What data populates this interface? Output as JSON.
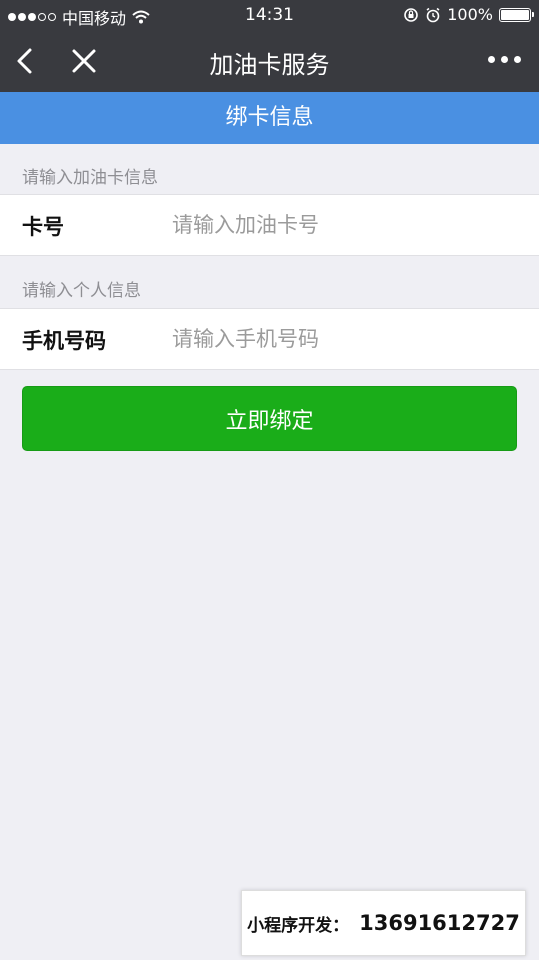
{
  "status_bar": {
    "carrier": "中国移动",
    "time": "14:31",
    "battery": "100%",
    "signal_bars_filled": 3,
    "signal_bars_total": 5,
    "battery_level": 1.0,
    "icons": [
      "wifi-icon",
      "orientation-lock-icon",
      "alarm-icon",
      "battery-icon"
    ]
  },
  "nav": {
    "title": "加油卡服务",
    "back_icon": "chevron-left-icon",
    "close_icon": "close-icon",
    "more_icon": "more-dots-icon"
  },
  "banner": {
    "title": "绑卡信息"
  },
  "card_section": {
    "label": "请输入加油卡信息",
    "field_label": "卡号",
    "placeholder": "请输入加油卡号",
    "value": ""
  },
  "personal_section": {
    "label": "请输入个人信息",
    "field_label": "手机号码",
    "placeholder": "请输入手机号码",
    "value": ""
  },
  "button": {
    "label": "立即绑定"
  },
  "watermark": {
    "label": "小程序开发：",
    "phone": "13691612727"
  },
  "colors": {
    "nav_bg": "#393a3f",
    "banner_bg": "#4a90e2",
    "button_bg": "#1aad19",
    "page_bg": "#efeff4"
  }
}
